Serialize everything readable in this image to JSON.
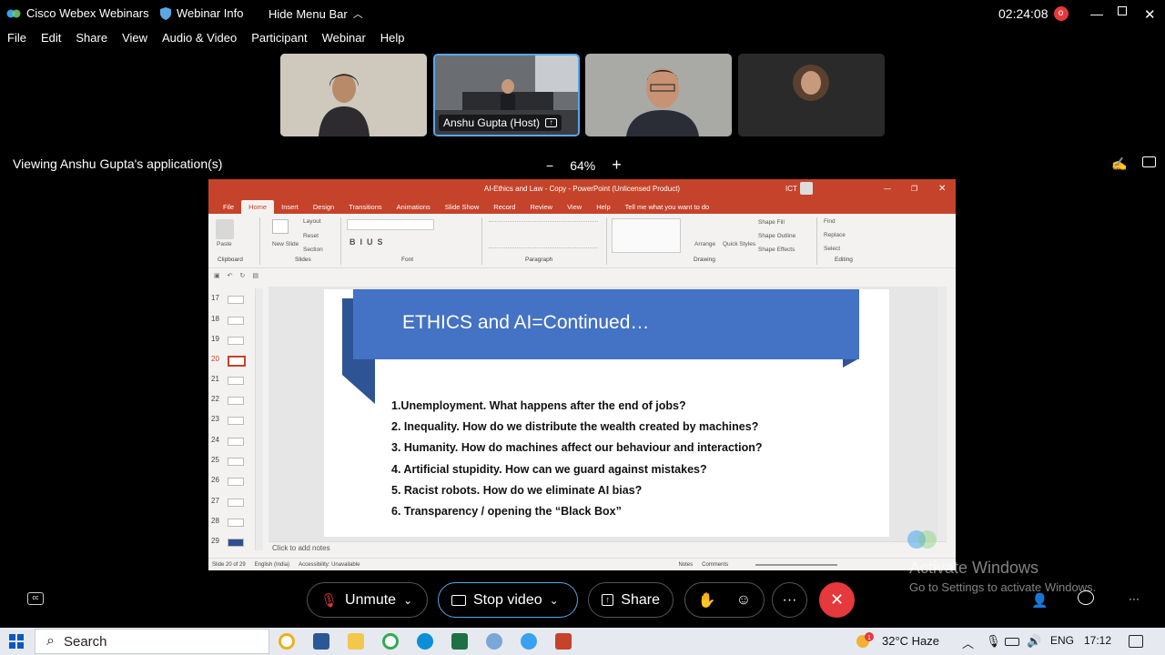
{
  "titlebar": {
    "app": "Cisco Webex Webinars",
    "info": "Webinar Info",
    "hide_menu": "Hide Menu Bar",
    "timer": "02:24:08"
  },
  "menubar": [
    "File",
    "Edit",
    "Share",
    "View",
    "Audio & Video",
    "Participant",
    "Webinar",
    "Help"
  ],
  "participants": {
    "host_label": "Anshu Gupta (Host)"
  },
  "viewing": "Viewing Anshu Gupta's application(s)",
  "zoom": {
    "minus": "−",
    "value": "64%",
    "plus": "+"
  },
  "ppt": {
    "title": "AI-Ethics and Law - Copy  -  PowerPoint (Unlicensed Product)",
    "user": "ICT",
    "tabs": [
      "File",
      "Home",
      "Insert",
      "Design",
      "Transitions",
      "Animations",
      "Slide Show",
      "Record",
      "Review",
      "View",
      "Help",
      "Tell me what you want to do"
    ],
    "ribbon_groups": [
      "Clipboard",
      "Slides",
      "Font",
      "Paragraph",
      "Drawing",
      "Editing"
    ],
    "ribbon_items": {
      "paste": "Paste",
      "new_slide": "New Slide",
      "layout": "Layout",
      "reset": "Reset",
      "section": "Section",
      "arrange": "Arrange",
      "quick_styles": "Quick Styles",
      "shape_fill": "Shape Fill",
      "shape_outline": "Shape Outline",
      "shape_effects": "Shape Effects",
      "find": "Find",
      "replace": "Replace",
      "select": "Select"
    },
    "slide_numbers": [
      "17",
      "18",
      "19",
      "20",
      "21",
      "22",
      "23",
      "24",
      "25",
      "26",
      "27",
      "28",
      "29"
    ],
    "slide_title": "ETHICS and AI=Continued…",
    "bullets": [
      "1.Unemployment. What happens after the end of jobs?",
      "2. Inequality. How do we distribute the wealth created by machines?",
      "3. Humanity. How do machines affect our behaviour and interaction?",
      "4. Artificial stupidity. How can we guard against mistakes?",
      "5. Racist robots. How do we eliminate AI bias?",
      "6. Transparency / opening the “Black Box”"
    ],
    "notes_placeholder": "Click to add notes",
    "status": {
      "slide": "Slide 20 of 29",
      "language": "English (India)",
      "accessibility": "Accessibility: Unavailable",
      "notes": "Notes",
      "comments": "Comments"
    }
  },
  "activate": {
    "line1": "Activate Windows",
    "line2": "Go to Settings to activate Windows."
  },
  "controls": {
    "unmute": "Unmute",
    "stop_video": "Stop video",
    "share": "Share",
    "more": "···"
  },
  "taskbar": {
    "search": "Search",
    "weather": "32°C  Haze",
    "lang": "ENG",
    "time": "17:12",
    "badge": "1"
  },
  "colors": {
    "ppt_accent": "#c5432a",
    "slide_banner": "#4472c4",
    "end_call": "#e5393b",
    "stop_video_border": "#5aa7e6"
  }
}
